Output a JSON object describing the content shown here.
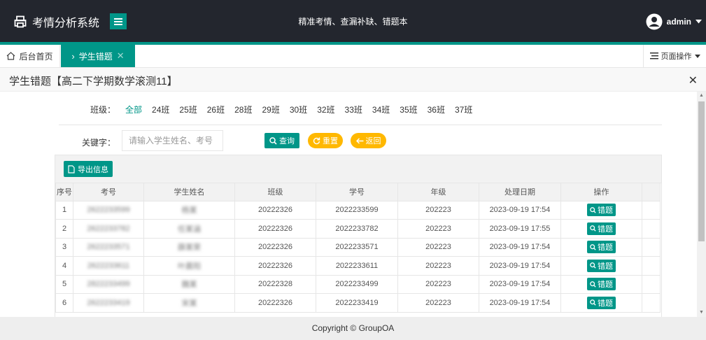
{
  "app": {
    "title": "考情分析系统",
    "slogan": "精准考情、查漏补缺、错题本",
    "user": "admin"
  },
  "tabs": {
    "home": "后台首页",
    "active": "学生错题",
    "page_ops": "页面操作"
  },
  "panel": {
    "title": "学生错题【高二下学期数学滚测11】"
  },
  "filter": {
    "class_label": "班级：",
    "classes": [
      "全部",
      "24班",
      "25班",
      "26班",
      "28班",
      "29班",
      "30班",
      "32班",
      "33班",
      "34班",
      "35班",
      "36班",
      "37班"
    ],
    "active_class": "全部"
  },
  "search": {
    "label": "关键字：",
    "placeholder": "请输入学生姓名、考号",
    "value": ""
  },
  "buttons": {
    "query": "查询",
    "reset": "重置",
    "back": "返回",
    "export": "导出信息",
    "row_action": "错题"
  },
  "table": {
    "columns": [
      "序号",
      "考号",
      "学生姓名",
      "班级",
      "学号",
      "年级",
      "处理日期",
      "操作"
    ],
    "rows": [
      {
        "no": "1",
        "exam_id": "2622233599",
        "name": "杨某",
        "class": "20222326",
        "student_id": "2022233599",
        "grade": "202223",
        "date": "2023-09-19 17:54"
      },
      {
        "no": "2",
        "exam_id": "2622233782",
        "name": "任某涵",
        "class": "20222326",
        "student_id": "2022233782",
        "grade": "202223",
        "date": "2023-09-19 17:55"
      },
      {
        "no": "3",
        "exam_id": "2622233571",
        "name": "薛某荣",
        "class": "20222326",
        "student_id": "2022233571",
        "grade": "202223",
        "date": "2023-09-19 17:54"
      },
      {
        "no": "4",
        "exam_id": "2622233611",
        "name": "叶晨阳",
        "class": "20222326",
        "student_id": "2022233611",
        "grade": "202223",
        "date": "2023-09-19 17:54"
      },
      {
        "no": "5",
        "exam_id": "2822233499",
        "name": "魏某",
        "class": "20222328",
        "student_id": "2022233499",
        "grade": "202223",
        "date": "2023-09-19 17:54"
      },
      {
        "no": "6",
        "exam_id": "2622233419",
        "name": "宋某",
        "class": "20222326",
        "student_id": "2022233419",
        "grade": "202223",
        "date": "2023-09-19 17:54"
      }
    ]
  },
  "footer": {
    "copyright": "Copyright © GroupOA"
  },
  "colors": {
    "accent": "#009688",
    "warning": "#ffb800",
    "header_bg": "#23262e"
  }
}
